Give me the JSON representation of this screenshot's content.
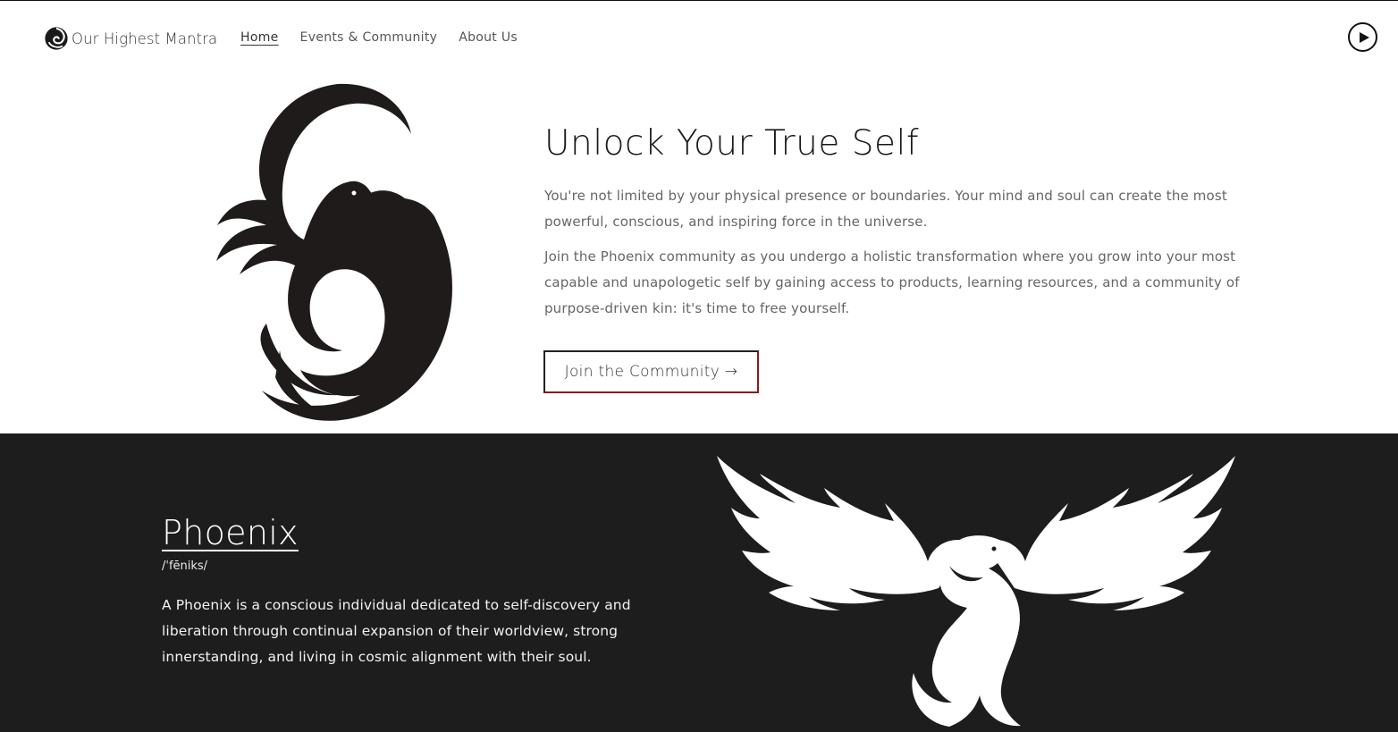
{
  "header": {
    "brand_name": "Our Highest Mantra",
    "nav": [
      "Home",
      "Events & Community",
      "About Us"
    ],
    "active_nav": "Home",
    "play_icon": "play-icon"
  },
  "hero": {
    "title": "Unlock Your True Self",
    "paragraph1": "You're not limited by your physical presence or boundaries. Your mind and soul can create the most powerful, conscious, and inspiring force in the universe.",
    "paragraph2": "Join the Phoenix community as you undergo a holistic transformation where you grow into your most capable and unapologetic self by gaining access to products, learning resources, and a community of purpose-driven kin: it's time to free yourself.",
    "cta_label": "Join the Community →",
    "image_icon": "phoenix-circle-icon"
  },
  "definition": {
    "word": "Phoenix",
    "pronunciation": "/ˈfēniks/",
    "description": "A Phoenix is a conscious individual dedicated to self-discovery and liberation through continual expansion of their worldview, strong innerstanding, and living in cosmic alignment with their soul.",
    "image_icon": "phoenix-spread-wings-icon"
  },
  "colors": {
    "dark_band": "#1d1d1d",
    "cta_accent": "#8a1a1a",
    "text_muted": "#666666"
  }
}
